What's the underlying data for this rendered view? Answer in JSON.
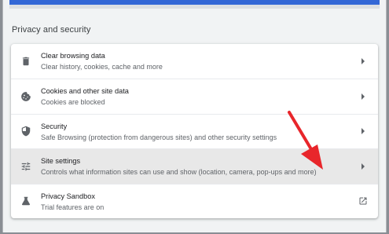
{
  "section": {
    "title": "Privacy and security"
  },
  "rows": [
    {
      "title": "Clear browsing data",
      "subtitle": "Clear history, cookies, cache and more",
      "icon": "trash-icon",
      "action_icon": "chevron-right-icon"
    },
    {
      "title": "Cookies and other site data",
      "subtitle": "Cookies are blocked",
      "icon": "cookie-icon",
      "action_icon": "chevron-right-icon"
    },
    {
      "title": "Security",
      "subtitle": "Safe Browsing (protection from dangerous sites) and other security settings",
      "icon": "shield-icon",
      "action_icon": "chevron-right-icon"
    },
    {
      "title": "Site settings",
      "subtitle": "Controls what information sites can use and show (location, camera, pop-ups and more)",
      "icon": "tune-sliders-icon",
      "action_icon": "chevron-right-icon",
      "highlighted": true
    },
    {
      "title": "Privacy Sandbox",
      "subtitle": "Trial features are on",
      "icon": "flask-icon",
      "action_icon": "open-in-new-icon"
    }
  ],
  "colors": {
    "accent_bar": "#3367d6",
    "annotation_arrow": "#e8262b",
    "highlight_row": "#e8e8e8"
  }
}
